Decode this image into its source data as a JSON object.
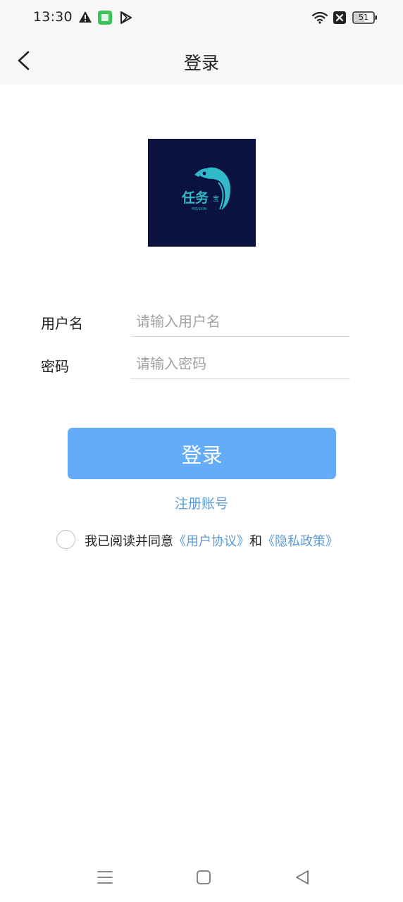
{
  "status": {
    "time": "13:30",
    "battery": "51",
    "icons": [
      "warning-icon",
      "app-notification-icon",
      "play-icon",
      "wifi-icon",
      "sim-blocked-icon",
      "battery-icon"
    ]
  },
  "nav": {
    "title": "登录",
    "back_icon": "chevron-left-icon"
  },
  "logo": {
    "text_main": "任务",
    "text_small": "宝",
    "text_sub": "MISSION",
    "bg_color": "#0c1240",
    "accent_color": "#2fb9c9"
  },
  "form": {
    "username_label": "用户名",
    "username_placeholder": "请输入用户名",
    "username_value": "",
    "password_label": "密码",
    "password_placeholder": "请输入密码",
    "password_value": ""
  },
  "actions": {
    "login_label": "登录",
    "register_label": "注册账号"
  },
  "agreement": {
    "prefix": "我已阅读并同意",
    "user_agreement": "《用户协议》",
    "and": "和",
    "privacy_policy": "《隐私政策》",
    "checked": false
  },
  "system_nav": [
    "menu-icon",
    "home-icon",
    "back-triangle-icon"
  ],
  "colors": {
    "primary_button": "#64acf8",
    "link": "#5b9bd5",
    "header_bg": "#f7f7f7"
  }
}
